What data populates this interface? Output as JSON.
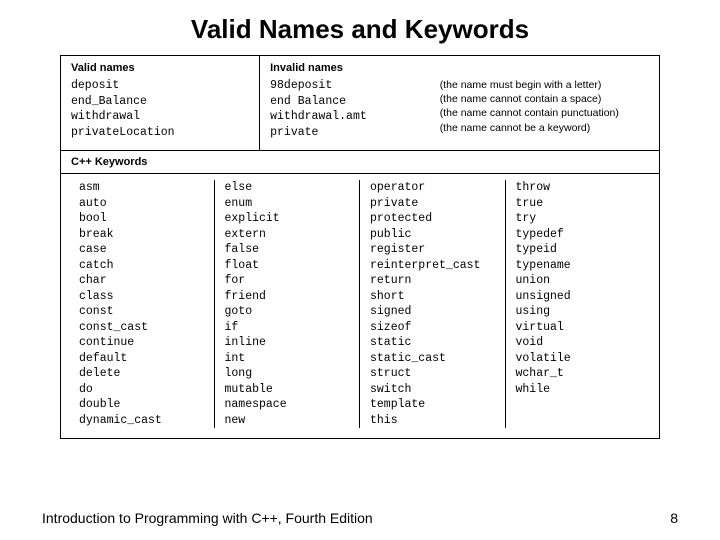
{
  "title": "Valid Names and Keywords",
  "sections": {
    "valid": {
      "heading": "Valid names",
      "items": [
        "deposit",
        "end_Balance",
        "withdrawal",
        "privateLocation"
      ]
    },
    "invalid": {
      "heading": "Invalid names",
      "items": [
        "98deposit",
        "end Balance",
        "withdrawal.amt",
        "private"
      ],
      "reasons": [
        "(the name must begin with a letter)",
        "(the name cannot contain a space)",
        "(the name cannot contain punctuation)",
        "(the name cannot be a keyword)"
      ]
    },
    "keywords_heading": "C++ Keywords"
  },
  "keywords": {
    "col1": [
      "asm",
      "auto",
      "bool",
      "break",
      "case",
      "catch",
      "char",
      "class",
      "const",
      "const_cast",
      "continue",
      "default",
      "delete",
      "do",
      "double",
      "dynamic_cast"
    ],
    "col2": [
      "else",
      "enum",
      "explicit",
      "extern",
      "false",
      "float",
      "for",
      "friend",
      "goto",
      "if",
      "inline",
      "int",
      "long",
      "mutable",
      "namespace",
      "new"
    ],
    "col3": [
      "operator",
      "private",
      "protected",
      "public",
      "register",
      "reinterpret_cast",
      "return",
      "short",
      "signed",
      "sizeof",
      "static",
      "static_cast",
      "struct",
      "switch",
      "template",
      "this"
    ],
    "col4": [
      "throw",
      "true",
      "try",
      "typedef",
      "typeid",
      "typename",
      "union",
      "unsigned",
      "using",
      "virtual",
      "void",
      "volatile",
      "wchar_t",
      "while"
    ]
  },
  "footer": {
    "left": "Introduction to Programming with C++, Fourth Edition",
    "right": "8"
  }
}
